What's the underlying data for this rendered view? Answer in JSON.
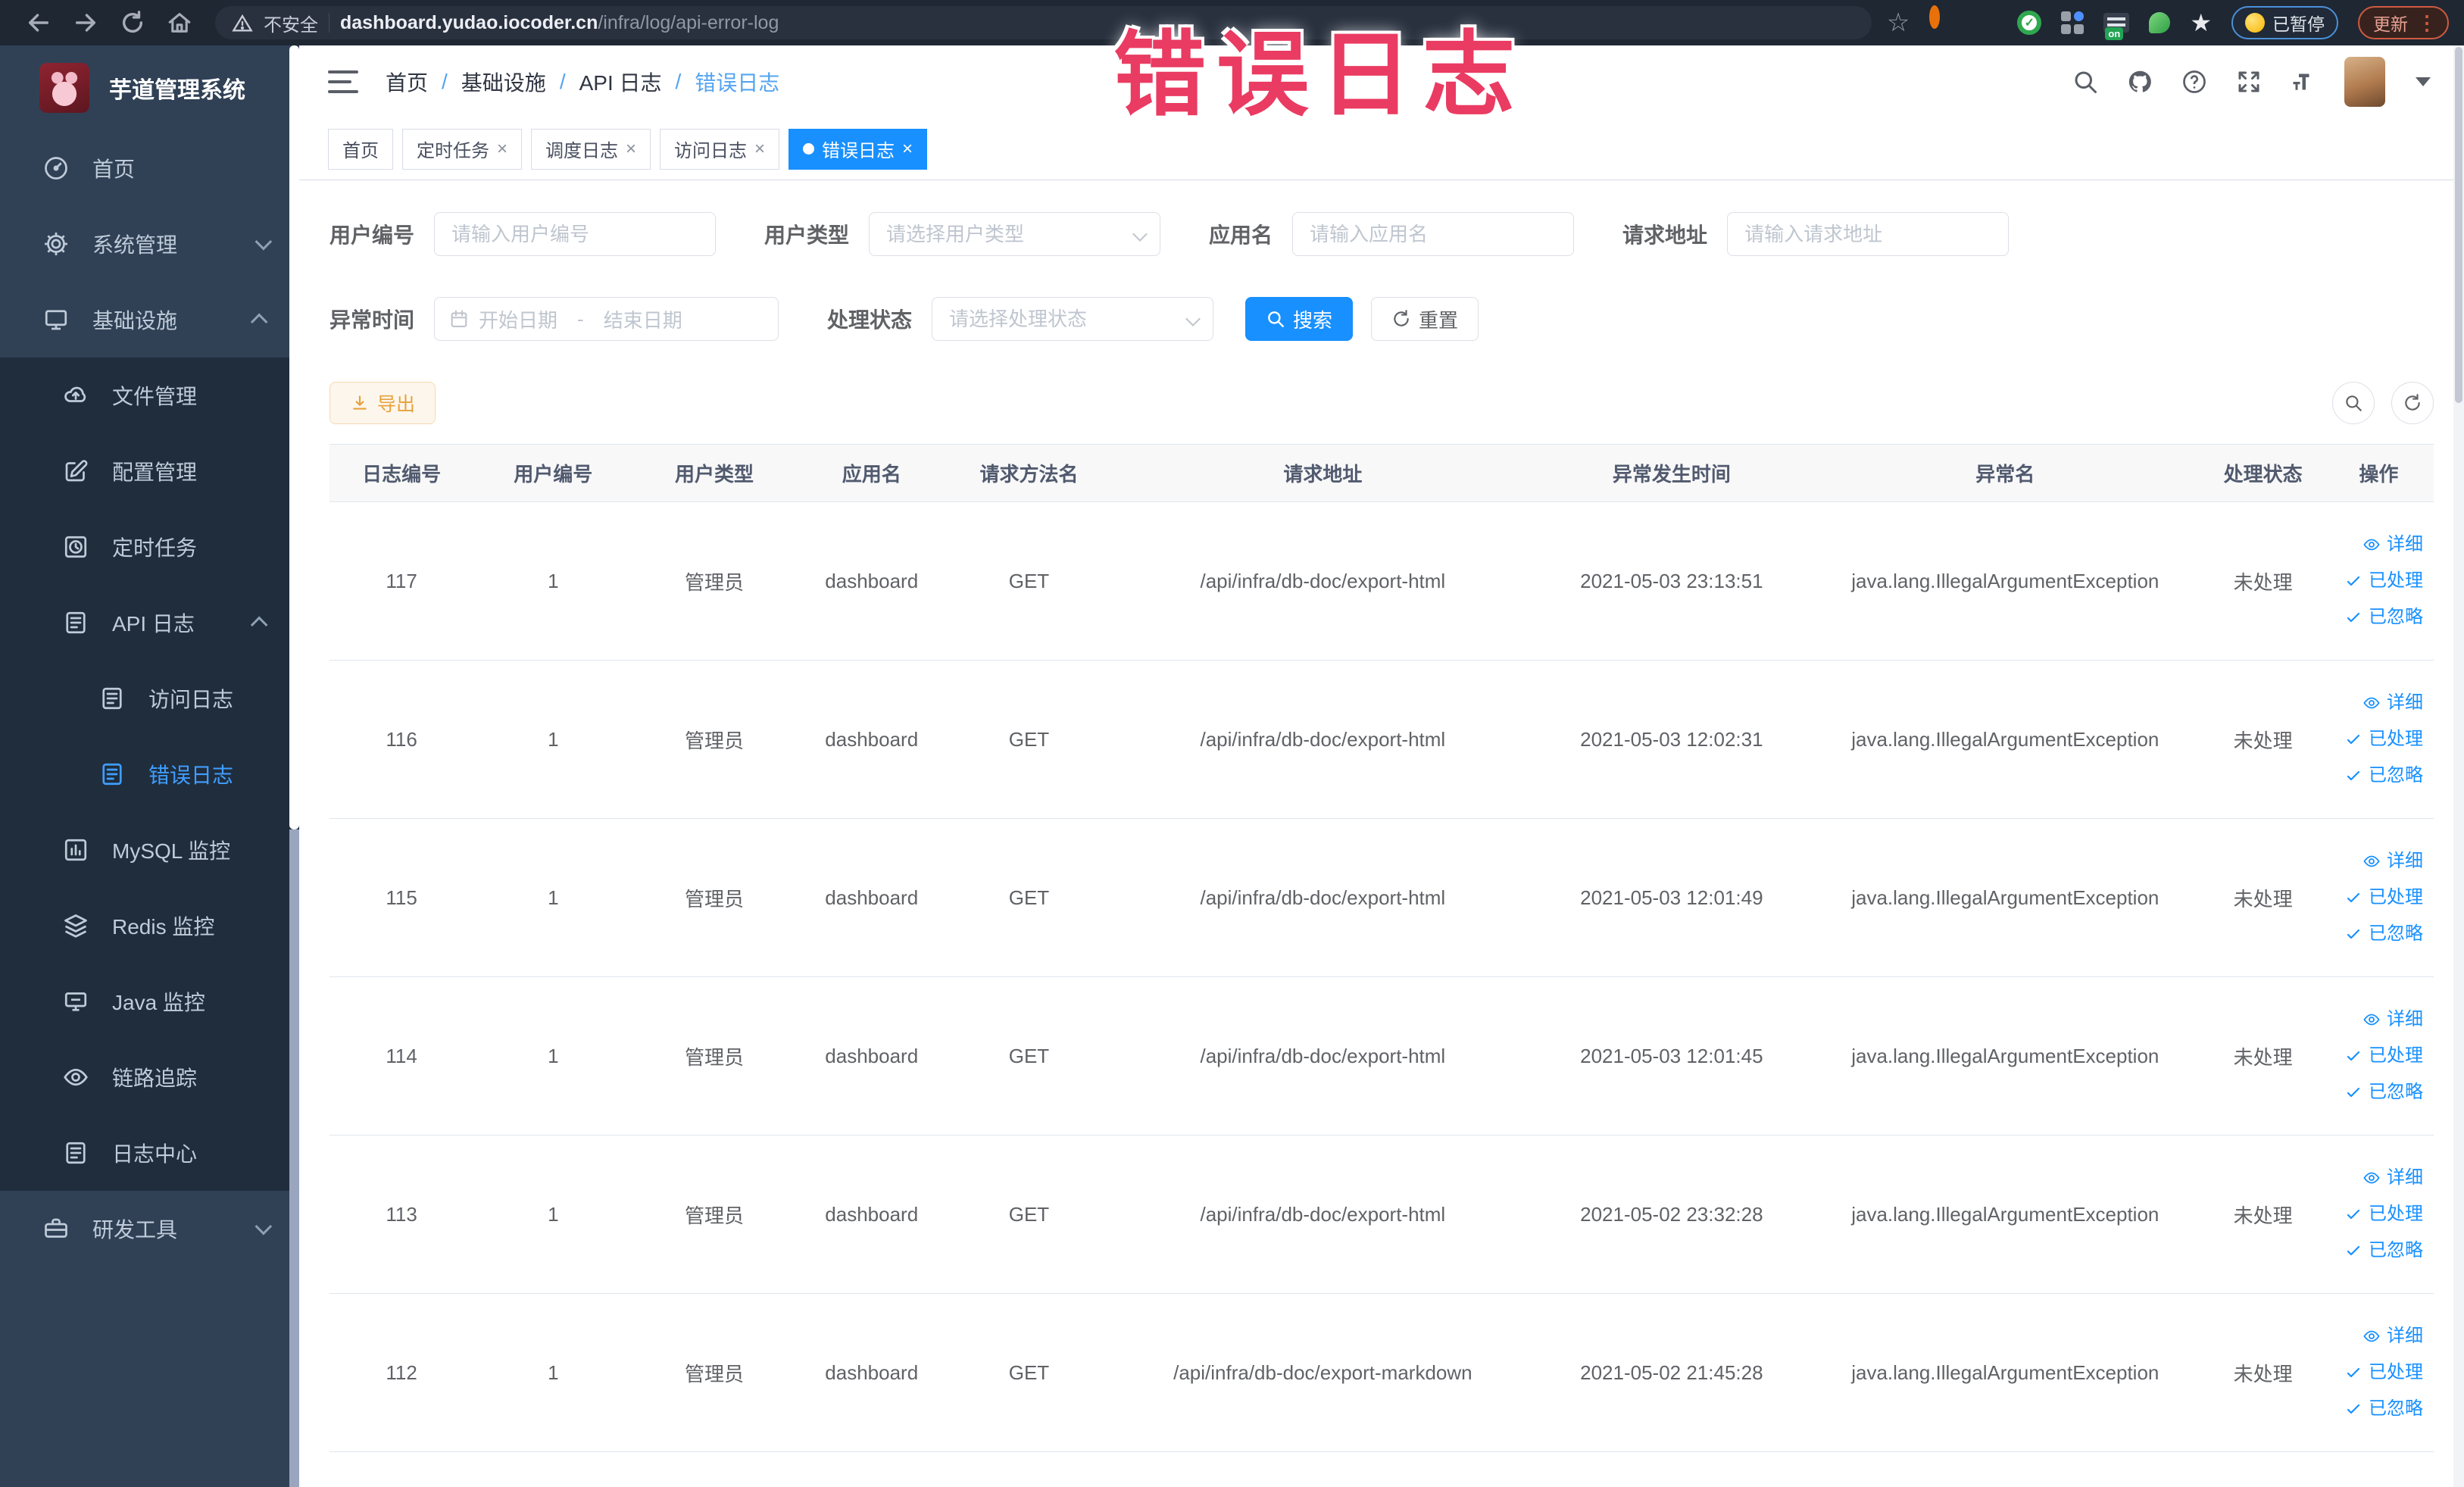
{
  "browser": {
    "security_label": "不安全",
    "url_host": "dashboard.yudao.iocoder.cn",
    "url_path": "/infra/log/api-error-log",
    "paused_badge": "已暂停",
    "update_button": "更新",
    "on_badge": "on"
  },
  "overlay": {
    "title": "错误日志"
  },
  "sidebar": {
    "app_title": "芋道管理系统",
    "items": [
      {
        "label": "首页",
        "icon": "gauge-icon"
      },
      {
        "label": "系统管理",
        "icon": "gear-icon"
      },
      {
        "label": "基础设施",
        "icon": "monitor-icon"
      },
      {
        "label": "文件管理",
        "icon": "cloud-icon"
      },
      {
        "label": "配置管理",
        "icon": "edit-icon"
      },
      {
        "label": "定时任务",
        "icon": "clock-icon"
      },
      {
        "label": "API 日志",
        "icon": "log-icon"
      },
      {
        "label": "访问日志",
        "icon": "log-icon"
      },
      {
        "label": "错误日志",
        "icon": "log-icon"
      },
      {
        "label": "MySQL 监控",
        "icon": "chart-icon"
      },
      {
        "label": "Redis 监控",
        "icon": "layers-icon"
      },
      {
        "label": "Java 监控",
        "icon": "screen-icon"
      },
      {
        "label": "链路追踪",
        "icon": "eye-icon"
      },
      {
        "label": "日志中心",
        "icon": "log-icon"
      },
      {
        "label": "研发工具",
        "icon": "toolbox-icon"
      }
    ]
  },
  "breadcrumb": {
    "items": [
      "首页",
      "基础设施",
      "API 日志",
      "错误日志"
    ],
    "separator": "/"
  },
  "tabs": [
    {
      "label": "首页"
    },
    {
      "label": "定时任务"
    },
    {
      "label": "调度日志"
    },
    {
      "label": "访问日志"
    },
    {
      "label": "错误日志"
    }
  ],
  "filters": {
    "user_id": {
      "label": "用户编号",
      "placeholder": "请输入用户编号"
    },
    "user_type": {
      "label": "用户类型",
      "placeholder": "请选择用户类型"
    },
    "app_name": {
      "label": "应用名",
      "placeholder": "请输入应用名"
    },
    "request_url": {
      "label": "请求地址",
      "placeholder": "请输入请求地址"
    },
    "exception_time": {
      "label": "异常时间",
      "start_placeholder": "开始日期",
      "end_placeholder": "结束日期",
      "separator": "-"
    },
    "process_status": {
      "label": "处理状态",
      "placeholder": "请选择处理状态"
    },
    "search_label": "搜索",
    "reset_label": "重置"
  },
  "toolbar": {
    "export_label": "导出"
  },
  "table": {
    "columns": [
      "日志编号",
      "用户编号",
      "用户类型",
      "应用名",
      "请求方法名",
      "请求地址",
      "异常发生时间",
      "异常名",
      "处理状态",
      "操作"
    ],
    "actions": {
      "detail": "详细",
      "processed": "已处理",
      "ignored": "已忽略"
    },
    "rows": [
      {
        "id": "117",
        "user_id": "1",
        "user_type": "管理员",
        "app": "dashboard",
        "method": "GET",
        "url": "/api/infra/db-doc/export-html",
        "time": "2021-05-03 23:13:51",
        "exception": "java.lang.IllegalArgumentException",
        "status": "未处理"
      },
      {
        "id": "116",
        "user_id": "1",
        "user_type": "管理员",
        "app": "dashboard",
        "method": "GET",
        "url": "/api/infra/db-doc/export-html",
        "time": "2021-05-03 12:02:31",
        "exception": "java.lang.IllegalArgumentException",
        "status": "未处理"
      },
      {
        "id": "115",
        "user_id": "1",
        "user_type": "管理员",
        "app": "dashboard",
        "method": "GET",
        "url": "/api/infra/db-doc/export-html",
        "time": "2021-05-03 12:01:49",
        "exception": "java.lang.IllegalArgumentException",
        "status": "未处理"
      },
      {
        "id": "114",
        "user_id": "1",
        "user_type": "管理员",
        "app": "dashboard",
        "method": "GET",
        "url": "/api/infra/db-doc/export-html",
        "time": "2021-05-03 12:01:45",
        "exception": "java.lang.IllegalArgumentException",
        "status": "未处理"
      },
      {
        "id": "113",
        "user_id": "1",
        "user_type": "管理员",
        "app": "dashboard",
        "method": "GET",
        "url": "/api/infra/db-doc/export-html",
        "time": "2021-05-02 23:32:28",
        "exception": "java.lang.IllegalArgumentException",
        "status": "未处理"
      },
      {
        "id": "112",
        "user_id": "1",
        "user_type": "管理员",
        "app": "dashboard",
        "method": "GET",
        "url": "/api/infra/db-doc/export-markdown",
        "time": "2021-05-02 21:45:28",
        "exception": "java.lang.IllegalArgumentException",
        "status": "未处理"
      }
    ]
  },
  "colors": {
    "primary": "#1890ff",
    "sidebar_bg": "#304156",
    "submenu_bg": "#1f2d3d",
    "sidebar_active_text": "#409eff",
    "warning": "#e6a23c",
    "overlay_red": "#ea3b62",
    "browser_bar_bg": "#1f2733"
  }
}
